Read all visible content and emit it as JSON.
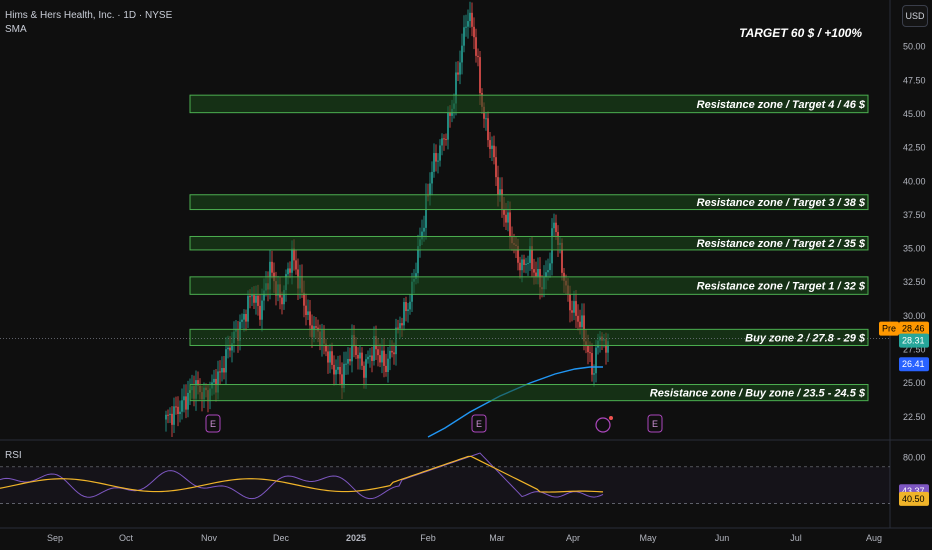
{
  "header": {
    "title": "Hims & Hers Health, Inc. · 1D · NYSE",
    "indicator": "SMA"
  },
  "currency": "USD",
  "target_text": "TARGET 60 $ / +100%",
  "y_axis": {
    "range": [
      21,
      53.1
    ],
    "ticks": [
      "22.50",
      "25.00",
      "27.50",
      "30.00",
      "32.50",
      "35.00",
      "37.50",
      "40.00",
      "42.50",
      "45.00",
      "47.50",
      "50.00"
    ],
    "tick_values": [
      22.5,
      25,
      27.5,
      30,
      32.5,
      35,
      37.5,
      40,
      42.5,
      45,
      47.5,
      50
    ]
  },
  "zones": [
    {
      "label": "Resistance zone / Target 4 / 46 $",
      "low": 45.1,
      "high": 46.4
    },
    {
      "label": "Resistance zone / Target 3 / 38 $",
      "low": 37.9,
      "high": 39.0
    },
    {
      "label": "Resistance zone / Target 2 / 35 $",
      "low": 34.9,
      "high": 35.9
    },
    {
      "label": "Resistance zone / Target 1 / 32 $",
      "low": 31.6,
      "high": 32.9
    },
    {
      "label": "Buy zone 2 / 27.8 - 29 $",
      "low": 27.8,
      "high": 29.0
    },
    {
      "label": "Resistance zone / Buy zone / 23.5 - 24.5 $",
      "low": 23.7,
      "high": 24.9
    }
  ],
  "price_badges": [
    {
      "label": "Pre",
      "value": "28.46",
      "price": 28.46,
      "color": "#ff9800"
    },
    {
      "label": "",
      "value": "28.31",
      "price": 28.31,
      "color": "#26a69a"
    },
    {
      "label": "",
      "value": "26.41",
      "price": 26.41,
      "color": "#2962ff"
    }
  ],
  "time_axis": [
    "Sep",
    "Oct",
    "Nov",
    "Dec",
    "2025",
    "Feb",
    "Mar",
    "Apr",
    "May",
    "Jun",
    "Jul",
    "Aug"
  ],
  "earnings_markers": [
    "E",
    "E",
    "E"
  ],
  "rsi": {
    "label": "RSI",
    "levels": [
      "80.00",
      "43.37",
      "40.50"
    ],
    "level_values": [
      80,
      43.37,
      40.5
    ],
    "range": [
      12,
      96
    ],
    "rsi_color": "#7e57c2",
    "ma_color": "#f0b429"
  },
  "colors": {
    "up": "#26a69a",
    "down": "#ef5350",
    "sma": "#2196f3",
    "zone_fill": "#1b4d1b",
    "zone_stroke": "#4caf50"
  }
}
